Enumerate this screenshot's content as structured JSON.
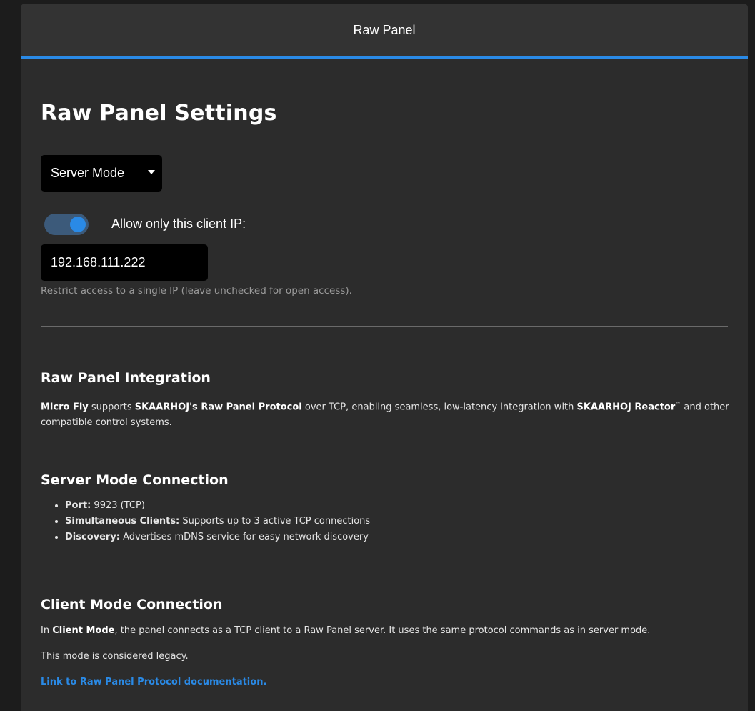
{
  "header": {
    "title": "Raw Panel"
  },
  "settings": {
    "title": "Raw Panel Settings",
    "mode_select": {
      "value": "Server Mode"
    },
    "allow_ip": {
      "label": "Allow only this client IP:",
      "enabled": true
    },
    "ip_field": {
      "value": "192.168.111.222"
    },
    "help": "Restrict access to a single IP (leave unchecked for open access)."
  },
  "integration": {
    "heading": "Raw Panel Integration",
    "product": "Micro Fly",
    "t1": " supports ",
    "protocol": "SKAARHOJ's Raw Panel Protocol",
    "t2": " over TCP, enabling seamless, low-latency integration with ",
    "reactor": "SKAARHOJ Reactor",
    "tm": "™",
    "t3": " and other compatible control systems."
  },
  "server_mode": {
    "heading": "Server Mode Connection",
    "items": [
      {
        "key": "Port:",
        "value": " 9923 (TCP)"
      },
      {
        "key": "Simultaneous Clients:",
        "value": " Supports up to 3 active TCP connections"
      },
      {
        "key": "Discovery:",
        "value": " Advertises mDNS service for easy network discovery"
      }
    ]
  },
  "client_mode": {
    "heading": "Client Mode Connection",
    "p1_pre": "In ",
    "p1_bold": "Client Mode",
    "p1_post": ", the panel connects as a TCP client to a Raw Panel server. It uses the same protocol commands as in server mode.",
    "p2": "This mode is considered legacy.",
    "link": "Link to Raw Panel Protocol documentation."
  },
  "colors": {
    "accent": "#2a8ae6",
    "panel": "#2c2c2c",
    "header": "#333333",
    "background": "#1c1c1c"
  }
}
